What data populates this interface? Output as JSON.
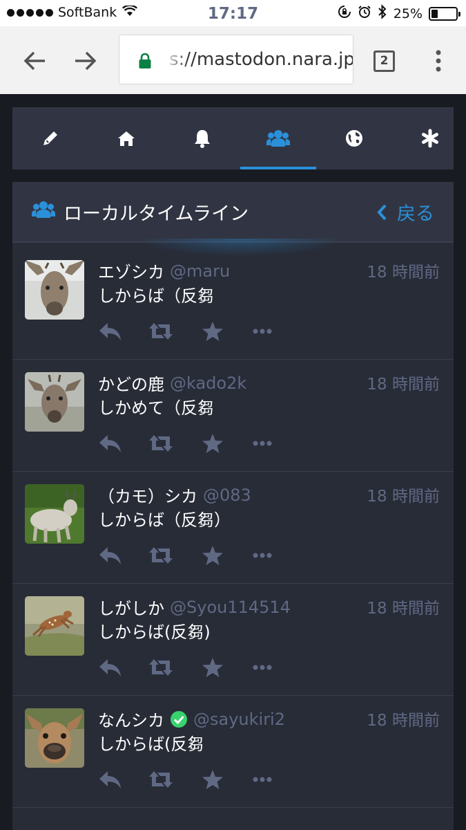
{
  "status_bar": {
    "carrier": "SoftBank",
    "time": "17:17",
    "battery": "25%",
    "battery_level": 0.25
  },
  "browser": {
    "url": "s://mastodon.nara.jp",
    "tab_count": "2"
  },
  "nav": {
    "tabs": [
      {
        "icon": "pencil-icon"
      },
      {
        "icon": "home-icon"
      },
      {
        "icon": "bell-icon"
      },
      {
        "icon": "users-icon",
        "active": true
      },
      {
        "icon": "globe-icon"
      },
      {
        "icon": "asterisk-icon"
      }
    ]
  },
  "column": {
    "title": "ローカルタイムライン",
    "back_label": "戻る"
  },
  "statuses": [
    {
      "display_name": "エゾシカ",
      "acct": "@maru",
      "time": "18 時間前",
      "content": "しからば（反芻",
      "verified": false
    },
    {
      "display_name": "かどの鹿",
      "acct": "@kado2k",
      "time": "18 時間前",
      "content": "しかめて（反芻",
      "verified": false
    },
    {
      "display_name": "（カモ）シカ",
      "acct": "@083",
      "time": "18 時間前",
      "content": "しからば（反芻）",
      "verified": false
    },
    {
      "display_name": "しがしか",
      "acct": "@Syou114514",
      "time": "18 時間前",
      "content": "しからば(反芻)",
      "verified": false
    },
    {
      "display_name": "なんシカ",
      "acct": "@sayukiri2",
      "time": "18 時間前",
      "content": "しからば(反芻",
      "verified": true
    }
  ],
  "colors": {
    "accent": "#2b90d9",
    "background": "#191b22",
    "column": "#282c37",
    "header": "#313543",
    "muted": "#606984"
  }
}
